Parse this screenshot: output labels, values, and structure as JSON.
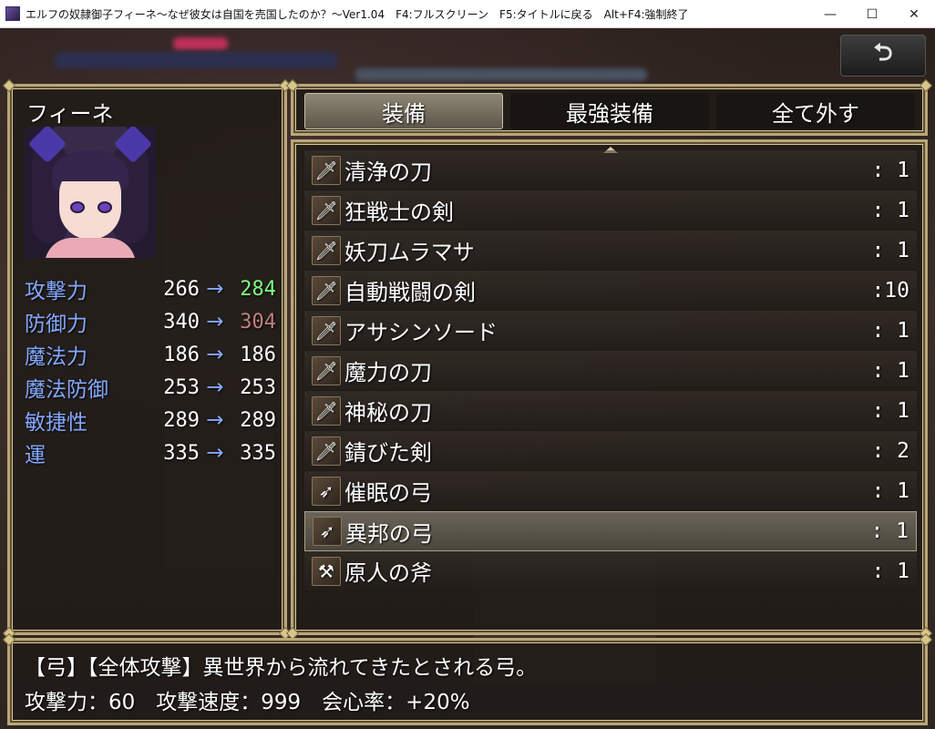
{
  "window": {
    "title": "エルフの奴隷御子フィーネ～なぜ彼女は自国を売国したのか？～Ver1.04　F4:フルスクリーン　F5:タイトルに戻る　Alt+F4:強制終了",
    "minimize": "—",
    "maximize": "☐",
    "close": "✕"
  },
  "back_button": {
    "glyph": "⮌"
  },
  "actor": {
    "name": "フィーネ",
    "params": [
      {
        "name": "攻撃力",
        "current": "266",
        "arrow": "→",
        "new": "284",
        "change": "up"
      },
      {
        "name": "防御力",
        "current": "340",
        "arrow": "→",
        "new": "304",
        "change": "down"
      },
      {
        "name": "魔法力",
        "current": "186",
        "arrow": "→",
        "new": "186",
        "change": "same"
      },
      {
        "name": "魔法防御",
        "current": "253",
        "arrow": "→",
        "new": "253",
        "change": "same"
      },
      {
        "name": "敏捷性",
        "current": "289",
        "arrow": "→",
        "new": "289",
        "change": "same"
      },
      {
        "name": "運",
        "current": "335",
        "arrow": "→",
        "new": "335",
        "change": "same"
      }
    ]
  },
  "commands": [
    {
      "label": "装備",
      "selected": true
    },
    {
      "label": "最強装備",
      "selected": false
    },
    {
      "label": "全て外す",
      "selected": false
    }
  ],
  "items": [
    {
      "name": "清浄の刀",
      "count": ":  1",
      "icon": "sword-icon",
      "glyph": "🗡"
    },
    {
      "name": "狂戦士の剣",
      "count": ":  1",
      "icon": "sword-icon",
      "glyph": "🗡"
    },
    {
      "name": "妖刀ムラマサ",
      "count": ":  1",
      "icon": "sword-icon",
      "glyph": "🗡"
    },
    {
      "name": "自動戦闘の剣",
      "count": ":10",
      "icon": "sword-icon",
      "glyph": "🗡"
    },
    {
      "name": "アサシンソード",
      "count": ":  1",
      "icon": "sword-icon",
      "glyph": "🗡"
    },
    {
      "name": "魔力の刀",
      "count": ":  1",
      "icon": "sword-icon",
      "glyph": "🗡"
    },
    {
      "name": "神秘の刀",
      "count": ":  1",
      "icon": "sword-icon",
      "glyph": "🗡"
    },
    {
      "name": "錆びた剣",
      "count": ":  2",
      "icon": "sword-icon",
      "glyph": "🗡"
    },
    {
      "name": "催眠の弓",
      "count": ":  1",
      "icon": "bow-icon",
      "glyph": "➶"
    },
    {
      "name": "異邦の弓",
      "count": ":  1",
      "icon": "bow-icon",
      "glyph": "➶",
      "selected": true
    },
    {
      "name": "原人の斧",
      "count": ":  1",
      "icon": "axe-icon",
      "glyph": "⚒"
    }
  ],
  "help": {
    "line1": "【弓】【全体攻撃】異世界から流れてきたとされる弓。",
    "line2": "攻撃力：60　攻撃速度：999　会心率：+20%"
  },
  "colors": {
    "system_blue": "#84a8ff",
    "power_up": "#80ff80",
    "power_down": "#c08080",
    "frame_gold": "#b9a67a"
  }
}
